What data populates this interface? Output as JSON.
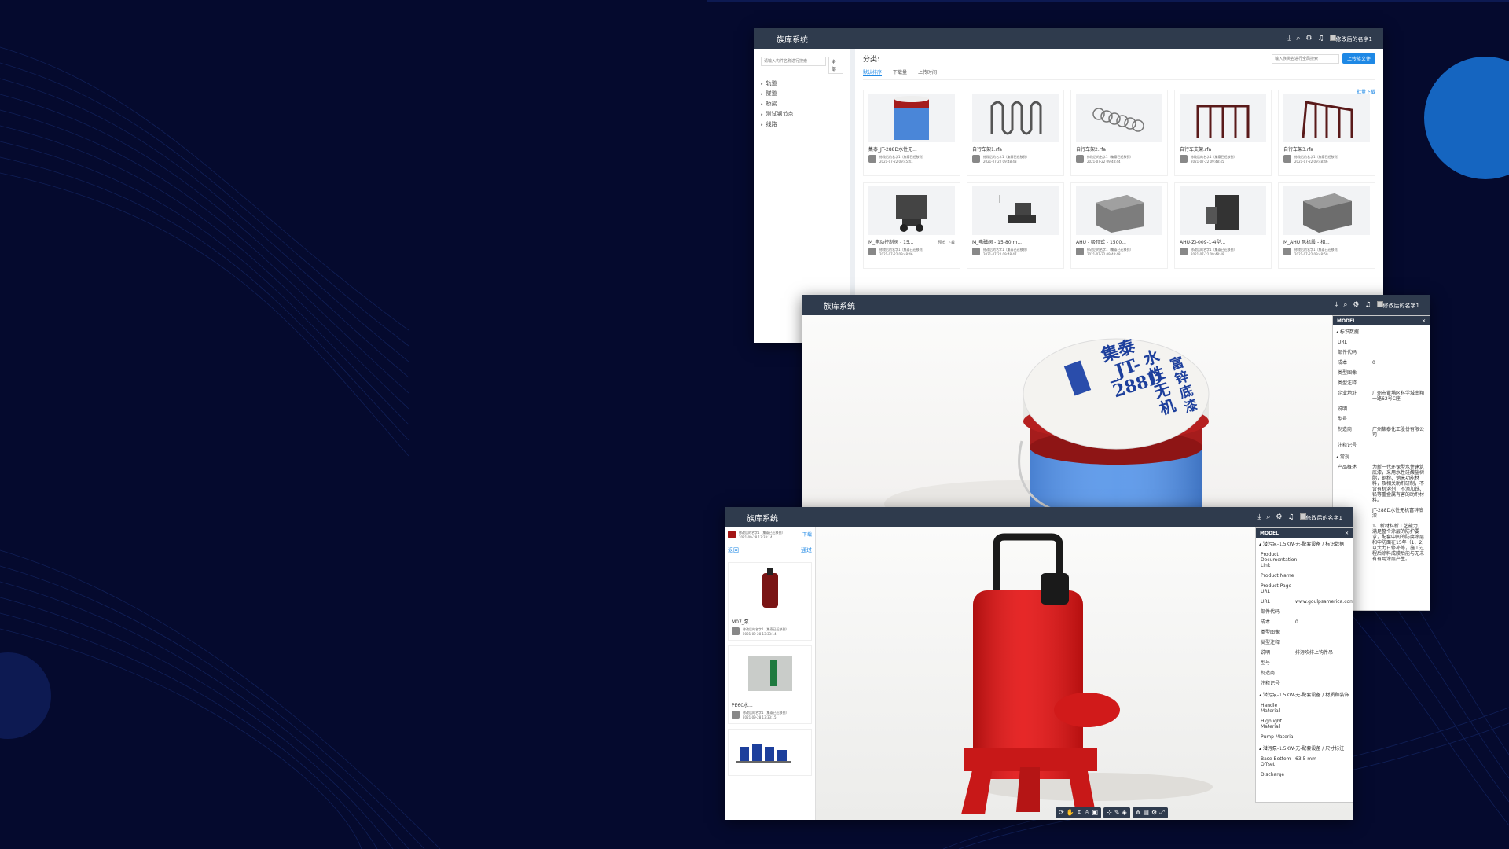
{
  "app_title": "族库系统",
  "user_name": "修改后的名字1",
  "colors": {
    "background": "#050a2e",
    "titlebar": "#2f3b4d",
    "accent": "#1e88e5"
  },
  "win1": {
    "sidebar": {
      "search_placeholder": "请输入构件名称进行搜索",
      "scope": "全部",
      "tree": [
        "轨道",
        "隧道",
        "桥梁",
        "测试钢节点",
        "线路"
      ]
    },
    "category_label": "分类:",
    "search_placeholder": "输入族类名进行全局搜索",
    "upload": "上传族文件",
    "batch_download": "批量下载",
    "tabs": [
      "默认排序",
      "下载量",
      "上传时间"
    ],
    "cards": [
      {
        "name": "集泰_JT-288D水性无...",
        "author": "修改后的名字1（集泰已迁移到）",
        "date": "2021-07-22 09:45:41",
        "thumb": "bucket"
      },
      {
        "name": "自行车架1.rfa",
        "author": "修改后的名字1（集泰已迁移到）",
        "date": "2021-07-22 09:48:43",
        "thumb": "wave"
      },
      {
        "name": "自行车架2.rfa",
        "author": "修改后的名字1（集泰已迁移到）",
        "date": "2021-07-22 09:48:44",
        "thumb": "coil"
      },
      {
        "name": "自行车支架.rfa",
        "author": "修改后的名字1（集泰已迁移到）",
        "date": "2021-07-22 09:48:45",
        "thumb": "rack"
      },
      {
        "name": "自行车架3.rfa",
        "author": "修改后的名字1（集泰已迁移到）",
        "date": "2021-07-22 09:48:46",
        "thumb": "rack2"
      },
      {
        "name": "M_电动控制阀 - 15...",
        "author": "修改后的名字1（集泰已迁移到）",
        "date": "2021-07-22 09:48:46",
        "thumb": "valve",
        "actions": "预览 下载"
      },
      {
        "name": "M_电磁阀 - 15-80 m...",
        "author": "修改后的名字1（集泰已迁移到）",
        "date": "2021-07-22 09:48:47",
        "thumb": "valve2"
      },
      {
        "name": "AHU - 吸顶式 - 1500...",
        "author": "修改后的名字1（集泰已迁移到）",
        "date": "2021-07-22 09:48:48",
        "thumb": "box"
      },
      {
        "name": "AHU-ZJ-009-1-4型...",
        "author": "修改后的名字1（集泰已迁移到）",
        "date": "2021-07-22 09:48:49",
        "thumb": "unit"
      },
      {
        "name": "M_AHU 风机段 - 相...",
        "author": "修改后的名字1（集泰已迁移到）",
        "date": "2021-07-22 09:48:50",
        "thumb": "box2"
      }
    ]
  },
  "win2": {
    "model_panel": {
      "title": "MODEL",
      "section": "标识数据",
      "rows": [
        {
          "k": "URL",
          "v": ""
        },
        {
          "k": "部件代码",
          "v": ""
        },
        {
          "k": "成本",
          "v": "0"
        },
        {
          "k": "类型图像",
          "v": ""
        },
        {
          "k": "类型注释",
          "v": ""
        },
        {
          "k": "企业地址",
          "v": "广州市黄埔区科学城南翔一路62号C座"
        },
        {
          "k": "说明",
          "v": ""
        },
        {
          "k": "型号",
          "v": ""
        },
        {
          "k": "制造商",
          "v": "广州集泰化工股份有限公司"
        },
        {
          "k": "注释记号",
          "v": ""
        }
      ],
      "section2": "常规",
      "desc_k": "产品概述",
      "desc_v": "为新一代环保型水性建筑底漆，采用水性硅酸盐树脂，钢粉、钠米功能材料，及相关助剂研制，不含有机溶剂，不添加铁、铅等重金属有害的助剂材料。",
      "extra_v": "JT-288D水性无机富锌底漆",
      "extra_v2": "1、新材料新工艺能力，满足整个涂层的防护要求，配套中间的防腐涂层和中防面在15年（1、2）以大力日修补等，施工过程后涂料成膜后能与无未有有用涂层产生。"
    },
    "label_top": "集泰_JT-288D",
    "label_mid": "水性无机",
    "label_bot": "富锌底漆"
  },
  "win3": {
    "side": {
      "user_line": "修改后的名字1（集泰已迁移到）",
      "date": "2021-09-28 13:33:14",
      "download": "下载",
      "back": "返回",
      "pick": "通过",
      "items": [
        {
          "name": "M07_泵...",
          "author": "修改后的名字1（集泰已迁移到）",
          "date": "2021-09-28 13:33:14"
        },
        {
          "name": "PE60水...",
          "author": "修改后的名字1（集泰已迁移到）",
          "date": "2021-09-28 13:33:15"
        }
      ]
    },
    "model_panel": {
      "title": "MODEL",
      "section1": "潜污泵-1.5KW-无-配套设备 / 标识数据",
      "rows1": [
        {
          "k": "Product Documentation Link",
          "v": ""
        },
        {
          "k": "Product Name",
          "v": ""
        },
        {
          "k": "Product Page URL",
          "v": ""
        },
        {
          "k": "URL",
          "v": "www.goulpsamerica.com",
          "link": true
        },
        {
          "k": "部件代码",
          "v": ""
        },
        {
          "k": "成本",
          "v": "0"
        },
        {
          "k": "类型图像",
          "v": ""
        },
        {
          "k": "类型注释",
          "v": ""
        },
        {
          "k": "说明",
          "v": "排污吹排上钩件吊"
        },
        {
          "k": "型号",
          "v": ""
        },
        {
          "k": "制造商",
          "v": ""
        },
        {
          "k": "注释记号",
          "v": ""
        }
      ],
      "section2": "潜污泵-1.5KW-无-配套设备 / 材质和装饰",
      "rows2": [
        {
          "k": "Handle Material",
          "v": ""
        },
        {
          "k": "Highlight Material",
          "v": ""
        },
        {
          "k": "Pump Material",
          "v": ""
        }
      ],
      "section3": "潜污泵-1.5KW-无-配套设备 / 尺寸标注",
      "rows3": [
        {
          "k": "Base Bottom Offset",
          "v": "63.5 mm"
        },
        {
          "k": "Discharge",
          "v": ""
        }
      ]
    }
  }
}
